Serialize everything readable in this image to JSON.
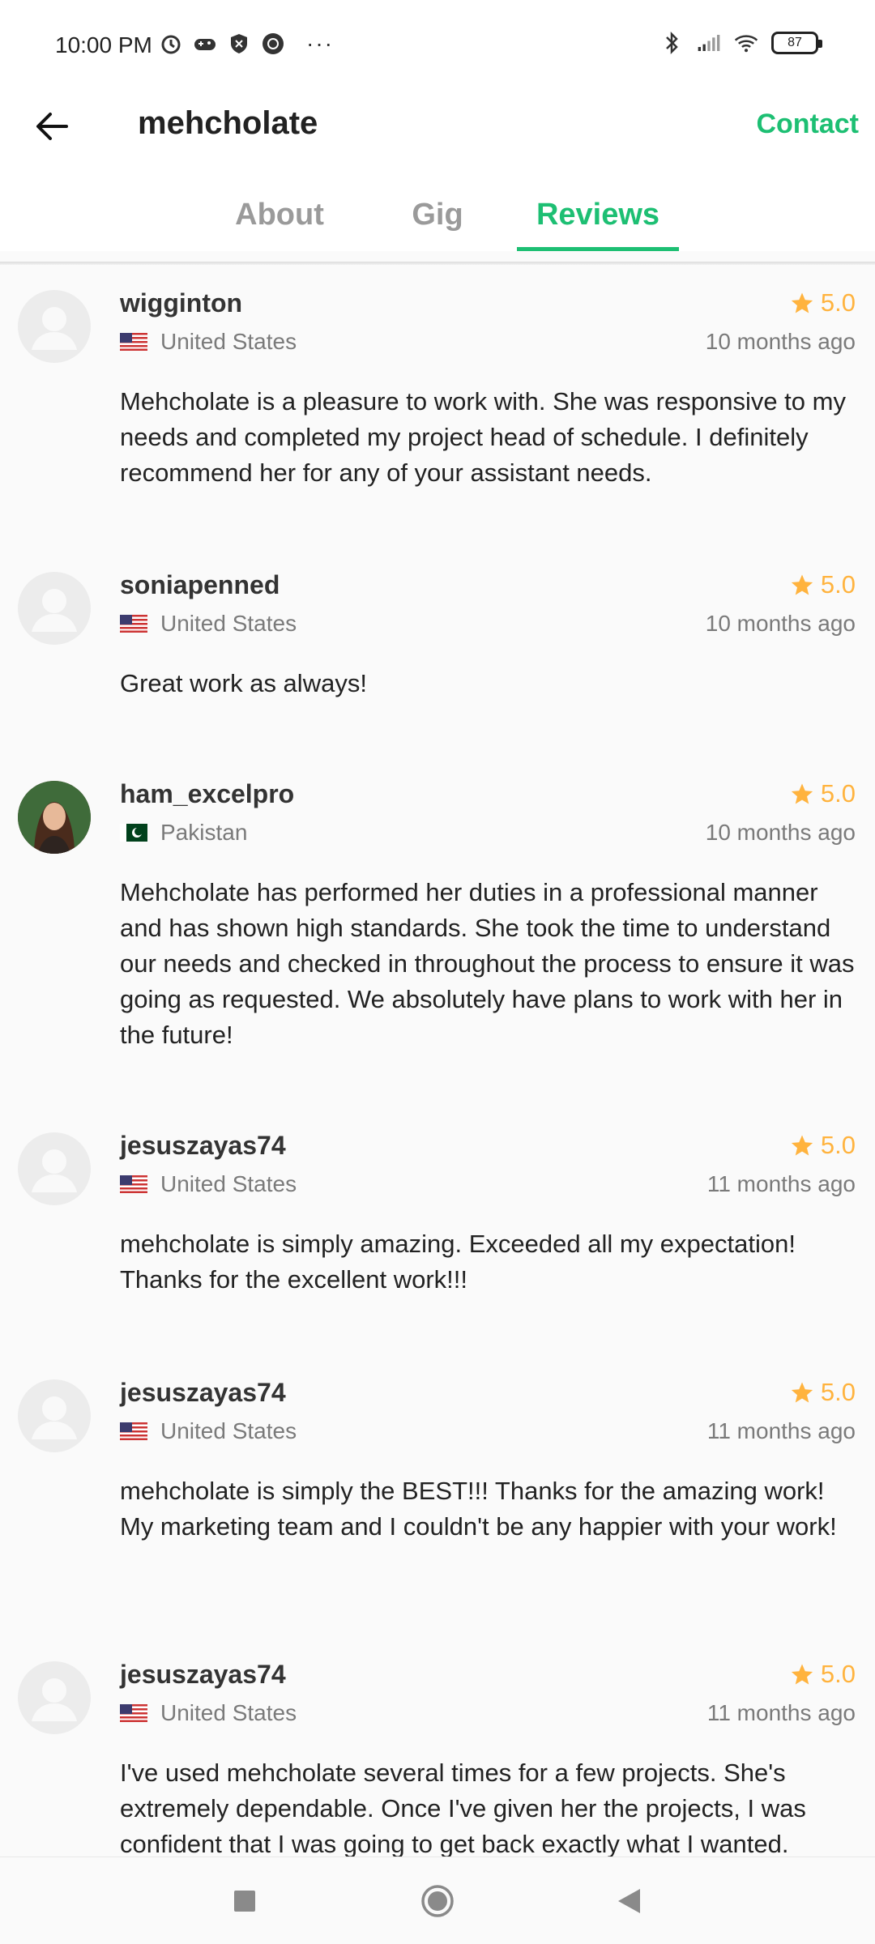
{
  "status": {
    "time": "10:00 PM",
    "dots": "···",
    "battery": "87"
  },
  "header": {
    "title": "mehcholate",
    "contact_label": "Contact"
  },
  "tabs": [
    {
      "label": "About"
    },
    {
      "label": "Gig"
    },
    {
      "label": "Reviews",
      "active": true
    }
  ],
  "reviews": [
    {
      "username": "wigginton",
      "country": "United States",
      "rating": "5.0",
      "time_ago": "10 months ago",
      "text": "Mehcholate is a pleasure to work with.  She was responsive to my needs and completed my project head of schedule.  I definitely recommend her for any of your assistant needs."
    },
    {
      "username": "soniapenned",
      "country": "United States",
      "rating": "5.0",
      "time_ago": "10 months ago",
      "text": "Great work as always!"
    },
    {
      "username": "ham_excelpro",
      "country": "Pakistan",
      "rating": "5.0",
      "time_ago": "10 months ago",
      "text": "Mehcholate has performed her duties in a professional manner and has shown high standards. She took the time to understand our needs and checked in throughout the process to ensure it was going as requested. We absolutely have plans to work with her in the future!"
    },
    {
      "username": "jesuszayas74",
      "country": "United States",
      "rating": "5.0",
      "time_ago": "11 months ago",
      "text": "mehcholate is simply amazing. Exceeded all my expectation! Thanks for the excellent work!!!"
    },
    {
      "username": "jesuszayas74",
      "country": "United States",
      "rating": "5.0",
      "time_ago": "11 months ago",
      "text": "mehcholate is simply the BEST!!! Thanks for the amazing work! My marketing team and I couldn't be any happier with your work!"
    },
    {
      "username": "jesuszayas74",
      "country": "United States",
      "rating": "5.0",
      "time_ago": "11 months ago",
      "text": "I've used mehcholate several times for a few projects. She's extremely dependable. Once I've given her the projects, I was confident that I was going to get back exactly what I wanted."
    }
  ],
  "colors": {
    "accent": "#1dbf73",
    "star": "#ffb33e"
  }
}
